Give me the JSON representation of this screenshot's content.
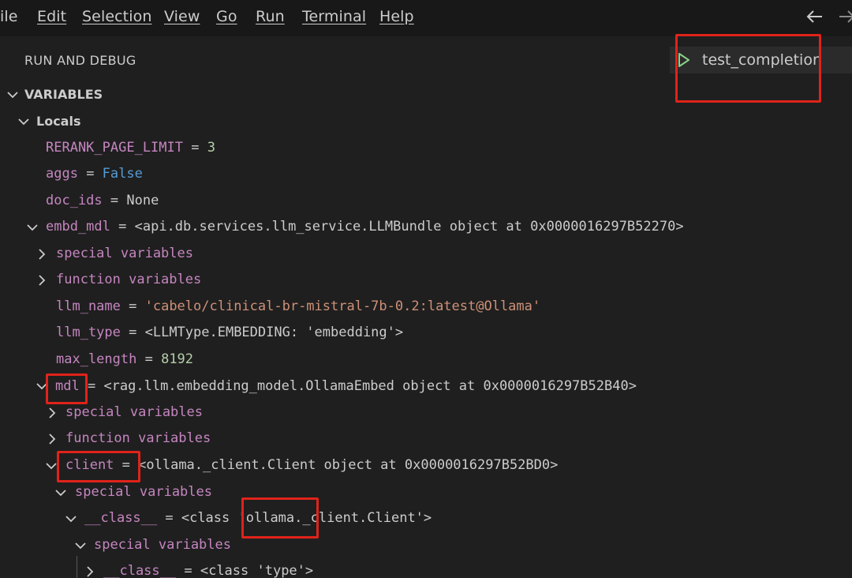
{
  "menu": {
    "file": "ile",
    "edit": "Edit",
    "selection": "Selection",
    "view": "View",
    "go": "Go",
    "run": "Run",
    "terminal": "Terminal",
    "help": "Help"
  },
  "panel": {
    "title": "RUN AND DEBUG",
    "config_name": "test_completion"
  },
  "variables": {
    "section": "VARIABLES",
    "scope": "Locals",
    "rows": [
      {
        "name": "RERANK_PAGE_LIMIT",
        "eq": " = ",
        "value": "3"
      },
      {
        "name": "aggs",
        "eq": " = ",
        "value": "False"
      },
      {
        "name": "doc_ids",
        "eq": " = ",
        "value": "None"
      },
      {
        "name": "embd_mdl",
        "eq": " = ",
        "value": "<api.db.services.llm_service.LLMBundle object at 0x0000016297B52270>"
      },
      {
        "name": "special variables"
      },
      {
        "name": "function variables"
      },
      {
        "name": "llm_name",
        "eq": " = ",
        "value": "'cabelo/clinical-br-mistral-7b-0.2:latest@Ollama'"
      },
      {
        "name": "llm_type",
        "eq": " = ",
        "value": "<LLMType.EMBEDDING: 'embedding'>"
      },
      {
        "name": "max_length",
        "eq": " = ",
        "value": "8192"
      },
      {
        "name": "mdl",
        "eq": " = ",
        "value": "<rag.llm.embedding_model.OllamaEmbed object at 0x0000016297B52B40>"
      },
      {
        "name": "special variables"
      },
      {
        "name": "function variables"
      },
      {
        "name": "client",
        "eq": " = ",
        "value": "<ollama._client.Client object at 0x0000016297B52BD0>"
      },
      {
        "name": "special variables"
      },
      {
        "name": "__class__",
        "eq": " = ",
        "value_a": "<class ",
        "value_b": "'ollama.",
        "value_c": "_client.Client'>"
      },
      {
        "name": "special variables"
      },
      {
        "name": "__class__",
        "eq": " = ",
        "value": "<class 'type'>"
      }
    ]
  },
  "colors": {
    "background": "#1f1f1f",
    "variable_name": "#c586c0",
    "number": "#b5cea8",
    "boolean": "#569cd6",
    "string": "#ce9178",
    "highlight": "#e0231a",
    "play": "#89d185"
  }
}
